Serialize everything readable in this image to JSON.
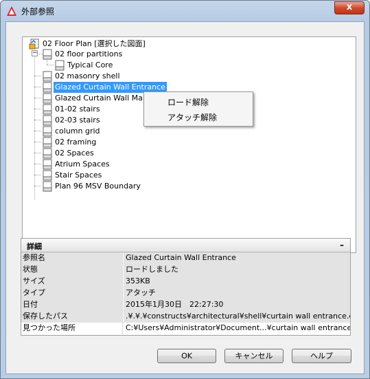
{
  "window": {
    "title": "外部参照"
  },
  "tree": {
    "root": "02 Floor Plan [選択した図面]",
    "items": [
      {
        "label": "02 floor partitions"
      },
      {
        "label": "Typical Core"
      },
      {
        "label": "02 masonry shell"
      },
      {
        "label": "Glazed Curtain Wall Entrance"
      },
      {
        "label": "Glazed Curtain Wall Main"
      },
      {
        "label": "01-02 stairs"
      },
      {
        "label": "02-03 stairs"
      },
      {
        "label": "column grid"
      },
      {
        "label": "02 framing"
      },
      {
        "label": "02 Spaces"
      },
      {
        "label": "Atrium Spaces"
      },
      {
        "label": "Stair Spaces"
      },
      {
        "label": "Plan 96 MSV Boundary"
      }
    ],
    "icon_text": "DWG",
    "expander_symbol": "−"
  },
  "context_menu": {
    "items": [
      "ロード解除",
      "アタッチ解除"
    ]
  },
  "details": {
    "title": "詳細",
    "collapse_symbol": "–",
    "rows": [
      {
        "key": "参照名",
        "value": "Glazed Curtain Wall Entrance"
      },
      {
        "key": "状態",
        "value": "ロードしました"
      },
      {
        "key": "サイズ",
        "value": "353KB"
      },
      {
        "key": "タイプ",
        "value": "アタッチ"
      },
      {
        "key": "日付",
        "value": "2015年1月30日　22:27:30"
      },
      {
        "key": "保存したパス",
        "value": ".¥.¥.¥constructs¥architectural¥shell¥curtain wall entrance.dwg"
      },
      {
        "key": "見つかった場所",
        "value": "C:¥Users¥Administrator¥Document...¥curtain wall entrance.dwg"
      }
    ]
  },
  "buttons": {
    "ok": "OK",
    "cancel": "キャンセル",
    "help": "ヘルプ",
    "close": "x"
  },
  "colors": {
    "selection": "#3399ff",
    "title_bar": "#b9cde5",
    "close_button": "#c23414"
  }
}
